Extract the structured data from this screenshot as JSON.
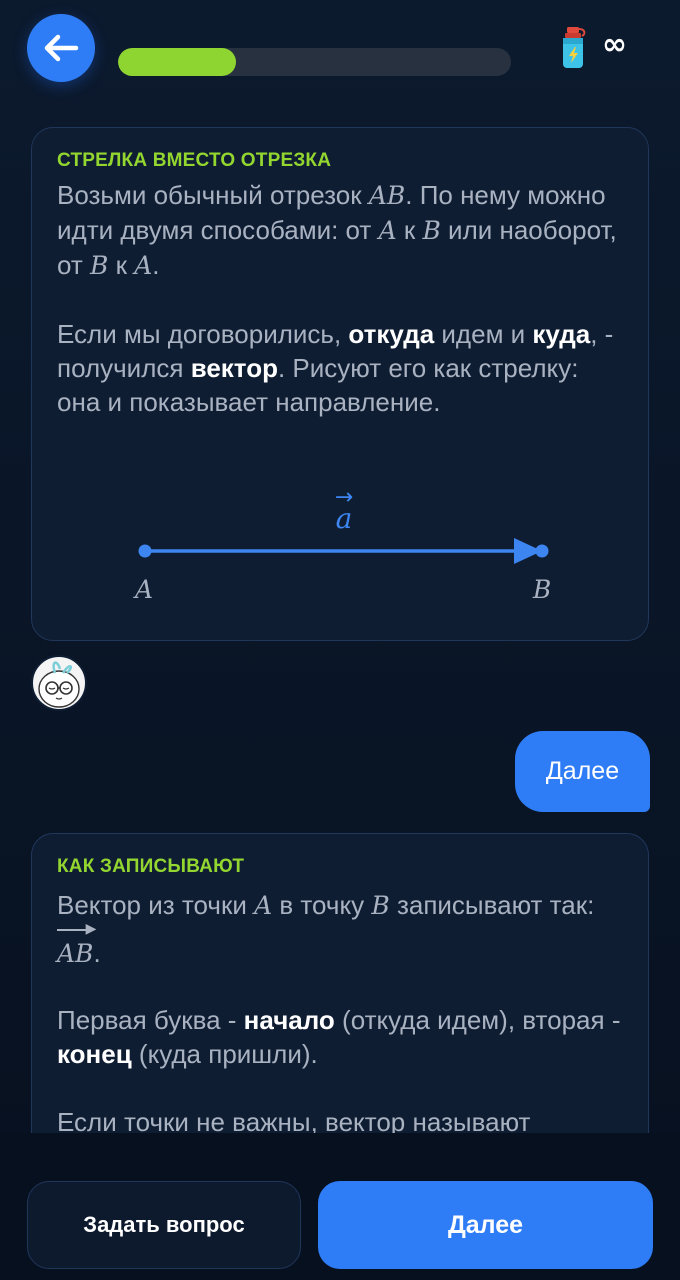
{
  "header": {
    "progress_fraction": 0.3,
    "lives_symbol": "∞"
  },
  "card1": {
    "title": "СТРЕЛКА ВМЕСТО ОТРЕЗКА",
    "p1": {
      "t1": "Возьми обычный отрезок ",
      "m1": "AB",
      "t2": ". По нему можно идти двумя способами: от ",
      "m2": "A",
      "t3": " к ",
      "m3": "B",
      "t4": " или наоборот, от ",
      "m4": "B",
      "t5": " к ",
      "m5": "A",
      "t6": "."
    },
    "p2": {
      "t1": "Если мы договорились, ",
      "b1": "откуда",
      "t2": " идем и ",
      "b2": "куда",
      "t3": ", - получился ",
      "b3": "вектор",
      "t4": ". Рисуют его как стрелку: она и показывает направление."
    },
    "diagram": {
      "vector_label": "a",
      "start_label": "A",
      "end_label": "B",
      "arrow_color": "#3d86f2",
      "label_color": "#a9b2c1"
    }
  },
  "chat": {
    "reply_label": "Далее"
  },
  "card2": {
    "title": "КАК ЗАПИСЫВАЮТ",
    "p1": {
      "t1": "Вектор из точки ",
      "m1": "A",
      "t2": " в точку ",
      "m2": "B",
      "t3": " записывают так: ",
      "m3": "AB",
      "t4": "."
    },
    "p2": {
      "t1": "Первая буква - ",
      "b1": "начало",
      "t2": " (откуда идем), вторая - ",
      "b2": "конец",
      "t3": " (куда пришли)."
    },
    "p3": {
      "t1": "Если точки не важны, вектор называют"
    }
  },
  "footer": {
    "ask_label": "Задать вопрос",
    "next_label": "Далее"
  },
  "colors": {
    "accent_blue": "#2f7df6",
    "accent_green": "#8fd531",
    "background": "#0a1526"
  },
  "icons": {
    "back": "arrow-left-icon",
    "bottle": "water-bottle-icon",
    "avatar": "mascot-avatar-icon"
  }
}
